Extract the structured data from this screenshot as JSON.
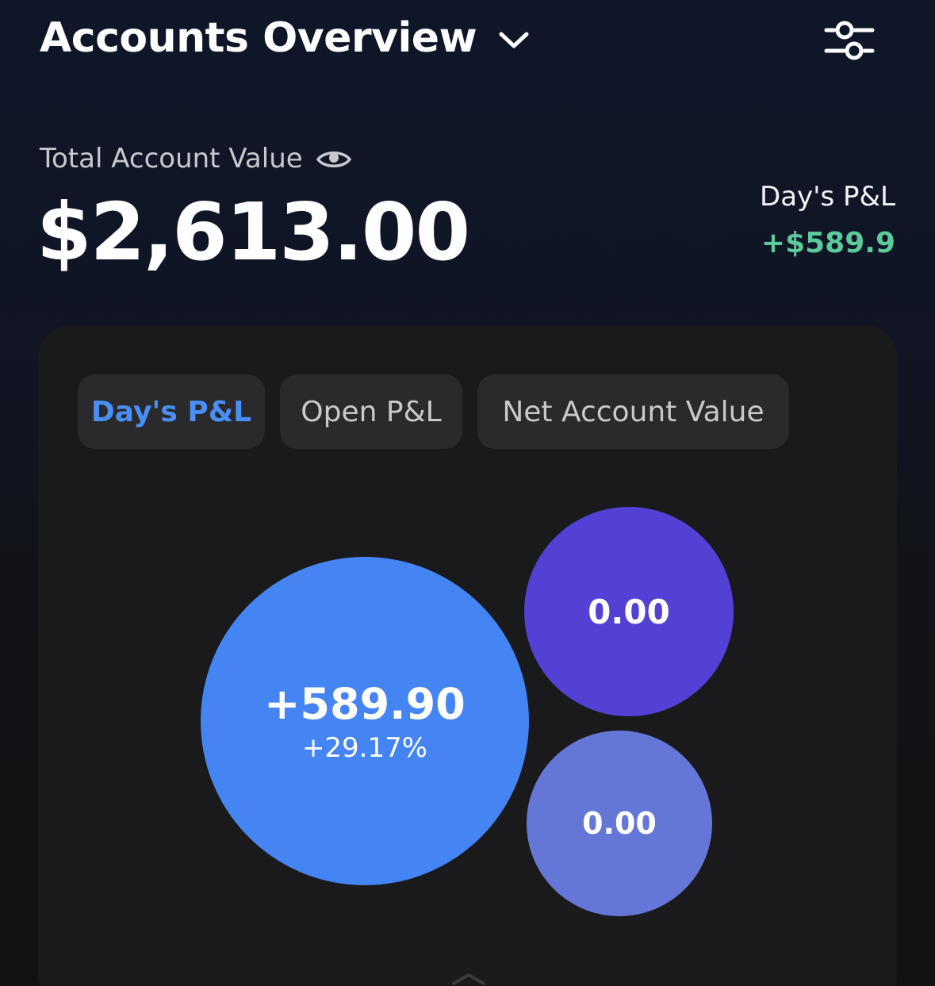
{
  "header": {
    "title": "Accounts Overview"
  },
  "summary": {
    "total_label": "Total Account Value",
    "total_value": "$2,613.00",
    "day_pl_label": "Day's P&L",
    "day_pl_value": "+$589.9"
  },
  "tabs": [
    {
      "label": "Day's P&L",
      "active": true
    },
    {
      "label": "Open P&L",
      "active": false
    },
    {
      "label": "Net Account Value",
      "active": false
    }
  ],
  "bubbles": [
    {
      "value": "+589.90",
      "percent": "+29.17%",
      "color": "#4585f3"
    },
    {
      "value": "0.00",
      "color": "#5241d4"
    },
    {
      "value": "0.00",
      "color": "#6577d6"
    }
  ],
  "colors": {
    "accent": "#4a8ff5",
    "gain": "#5cc99a"
  },
  "icons": {
    "dropdown": "chevron-down-icon",
    "settings": "sliders-icon",
    "visibility": "eye-icon",
    "sheet_handle": "chevron-up-icon"
  }
}
